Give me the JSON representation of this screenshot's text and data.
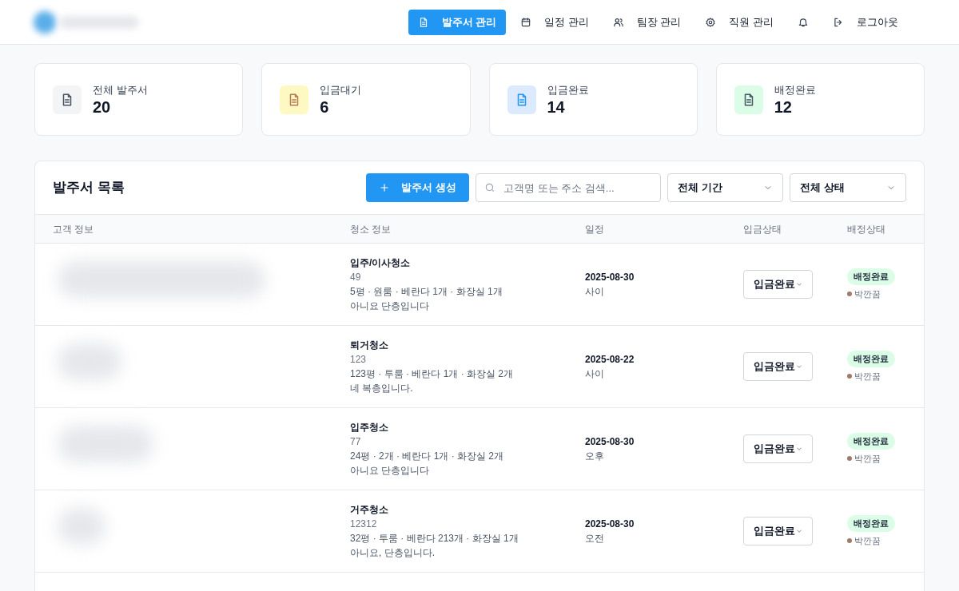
{
  "nav": {
    "items": [
      {
        "label": "발주서 관리",
        "kind": "orders",
        "selected": true
      },
      {
        "label": "일정 관리",
        "kind": "schedule",
        "selected": false
      },
      {
        "label": "팀장 관리",
        "kind": "leaders",
        "selected": false
      },
      {
        "label": "직원 관리",
        "kind": "staff",
        "selected": false
      },
      {
        "kind": "notifications",
        "selected": false
      },
      {
        "label": "로그아웃",
        "kind": "logout",
        "selected": false
      }
    ]
  },
  "stats": [
    {
      "label": "전체 발주서",
      "value": "20",
      "kind": "total"
    },
    {
      "label": "입금대기",
      "value": "6",
      "kind": "waiting"
    },
    {
      "label": "입금완료",
      "value": "14",
      "kind": "paid"
    },
    {
      "label": "배정완료",
      "value": "12",
      "kind": "assigned"
    }
  ],
  "list": {
    "title": "발주서 목록",
    "create_button": "발주서 생성",
    "search": {
      "placeholder": "고객명 또는 주소 검색..."
    },
    "filters": [
      "전체 기간",
      "전체 상태"
    ],
    "columns": [
      "고객 정보",
      "청소 정보",
      "일정",
      "입금상태",
      "배정상태"
    ],
    "rows": [
      {
        "cleaning_type": "입주/이사청소",
        "code": "49",
        "details": "5평 · 원룸 · 베란다 1개 · 화장실 1개",
        "note": "아니요 단층입니다",
        "date": "2025-08-30",
        "time": "사이",
        "payment": "입금완료",
        "assignment": "배정완료",
        "assignee": "박깐꿈"
      },
      {
        "cleaning_type": "퇴거청소",
        "code": "123",
        "details": "123평 · 투룸 · 베란다 1개 · 화장실 2개",
        "note": "네 복층입니다.",
        "date": "2025-08-22",
        "time": "사이",
        "payment": "입금완료",
        "assignment": "배정완료",
        "assignee": "박깐꿈"
      },
      {
        "cleaning_type": "입주청소",
        "code": "77",
        "details": "24평 · 2개 · 베란다 1개 · 화장실 2개",
        "note": "아니요 단층입니다",
        "date": "2025-08-30",
        "time": "오후",
        "payment": "입금완료",
        "assignment": "배정완료",
        "assignee": "박깐꿈"
      },
      {
        "cleaning_type": "거주청소",
        "code": "12312",
        "details": "32평 · 투룸 · 베란다 213개 · 화장실 1개",
        "note": "아니요, 단층입니다.",
        "date": "2025-08-30",
        "time": "오전",
        "payment": "입금완료",
        "assignment": "배정완료",
        "assignee": "박깐꿈"
      }
    ]
  }
}
